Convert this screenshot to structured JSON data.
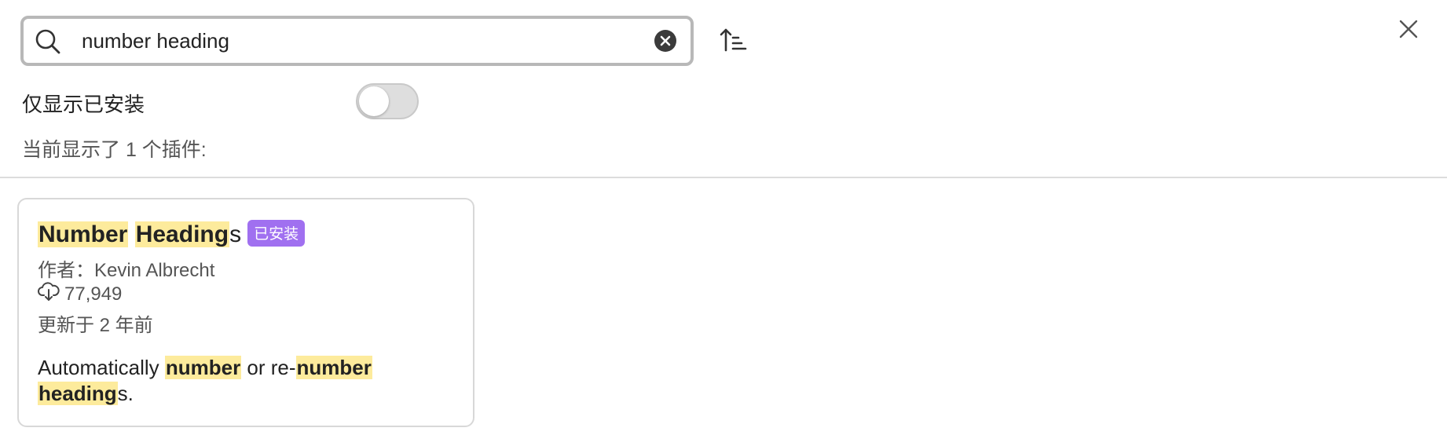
{
  "search": {
    "value": "number heading",
    "placeholder": "",
    "icon": "search-icon",
    "clear_icon": "clear-circle-icon"
  },
  "toolbar": {
    "sort_icon": "sort-ascending-icon",
    "close_icon": "close-icon"
  },
  "filter": {
    "installed_only_label": "仅显示已安装",
    "installed_only_on": false
  },
  "result_count": "当前显示了 1 个插件:",
  "plugins": [
    {
      "title_hl_1": "Number",
      "title_hl_2": "Heading",
      "title_rest": "s",
      "badge": "已安装",
      "author": "作者：Kevin Albrecht",
      "downloads": "77,949",
      "updated": "更新于 2 年前",
      "desc_text_1": "Automatically ",
      "desc_hl_1": "number",
      "desc_text_2": " or re-",
      "desc_hl_2": "number",
      "desc_hl_3": "heading",
      "desc_text_3": "s."
    }
  ],
  "colors": {
    "highlight": "#fdeb9c",
    "badge": "#a070f0",
    "border": "#d8d8d8"
  }
}
